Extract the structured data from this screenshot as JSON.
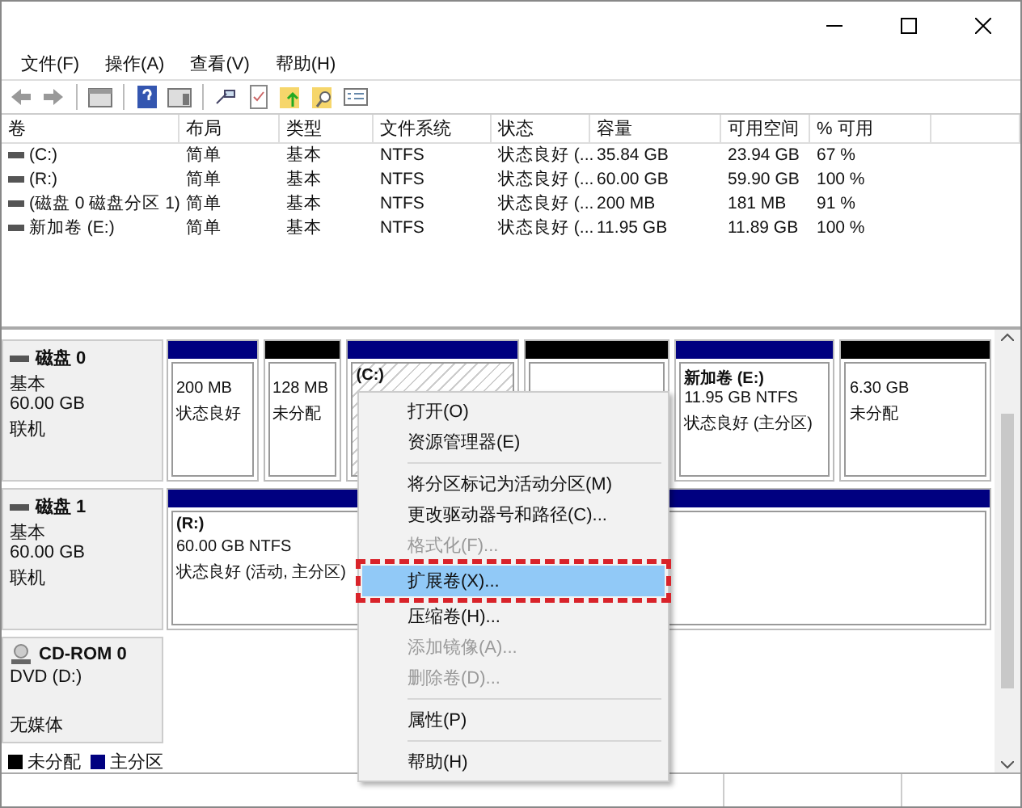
{
  "menubar": [
    "文件(F)",
    "操作(A)",
    "查看(V)",
    "帮助(H)"
  ],
  "volume_table": {
    "columns": [
      "卷",
      "布局",
      "类型",
      "文件系统",
      "状态",
      "容量",
      "可用空间",
      "% 可用"
    ],
    "rows": [
      [
        "(C:)",
        "简单",
        "基本",
        "NTFS",
        "状态良好 (...",
        "35.84 GB",
        "23.94 GB",
        "67 %"
      ],
      [
        "(R:)",
        "简单",
        "基本",
        "NTFS",
        "状态良好 (...",
        "60.00 GB",
        "59.90 GB",
        "100 %"
      ],
      [
        "(磁盘 0 磁盘分区 1)",
        "简单",
        "基本",
        "NTFS",
        "状态良好 (...",
        "200 MB",
        "181 MB",
        "91 %"
      ],
      [
        "新加卷 (E:)",
        "简单",
        "基本",
        "NTFS",
        "状态良好 (...",
        "11.95 GB",
        "11.89 GB",
        "100 %"
      ]
    ]
  },
  "disks": [
    {
      "kind": "disk",
      "name": "磁盘 0",
      "lines": [
        "基本",
        "60.00 GB",
        "联机"
      ],
      "partitions": [
        {
          "kind": "primary",
          "selected": false,
          "lines": [
            "200 MB",
            "状态良好"
          ]
        },
        {
          "kind": "unallocated",
          "selected": false,
          "lines": [
            "128 MB",
            "未分配"
          ]
        },
        {
          "kind": "primary",
          "selected": true,
          "title": "(C:)"
        },
        {
          "kind": "unallocated",
          "selected": false
        },
        {
          "kind": "primary",
          "selected": false,
          "title": "新加卷  (E:)",
          "lines": [
            "11.95 GB NTFS",
            "状态良好 (主分区)"
          ]
        },
        {
          "kind": "unallocated",
          "selected": false,
          "lines": [
            "6.30 GB",
            "未分配"
          ]
        }
      ]
    },
    {
      "kind": "disk",
      "name": "磁盘 1",
      "lines": [
        "基本",
        "60.00 GB",
        "联机"
      ],
      "partitions": [
        {
          "kind": "primary",
          "selected": false,
          "title": "(R:)",
          "lines": [
            "60.00 GB NTFS",
            "状态良好 (活动, 主分区)"
          ]
        }
      ]
    },
    {
      "kind": "cdrom",
      "name": "CD-ROM 0",
      "lines": [
        "DVD (D:)",
        "无媒体"
      ]
    }
  ],
  "legend": [
    {
      "kind": "unallocated",
      "label": "未分配"
    },
    {
      "kind": "primary",
      "label": "主分区"
    }
  ],
  "context_menu": {
    "groups": [
      [
        {
          "label": "打开(O)",
          "disabled": false,
          "selected": false
        },
        {
          "label": "资源管理器(E)",
          "disabled": false,
          "selected": false
        }
      ],
      [
        {
          "label": "将分区标记为活动分区(M)",
          "disabled": false,
          "selected": false
        },
        {
          "label": "更改驱动器号和路径(C)...",
          "disabled": false,
          "selected": false
        },
        {
          "label": "格式化(F)...",
          "disabled": true,
          "selected": false
        },
        {
          "label": "扩展卷(X)...",
          "disabled": false,
          "selected": true,
          "highlighted": true
        },
        {
          "label": "压缩卷(H)...",
          "disabled": false,
          "selected": false
        },
        {
          "label": "添加镜像(A)...",
          "disabled": true,
          "selected": false
        },
        {
          "label": "删除卷(D)...",
          "disabled": true,
          "selected": false
        }
      ],
      [
        {
          "label": "属性(P)",
          "disabled": false,
          "selected": false
        }
      ],
      [
        {
          "label": "帮助(H)",
          "disabled": false,
          "selected": false
        }
      ]
    ]
  }
}
